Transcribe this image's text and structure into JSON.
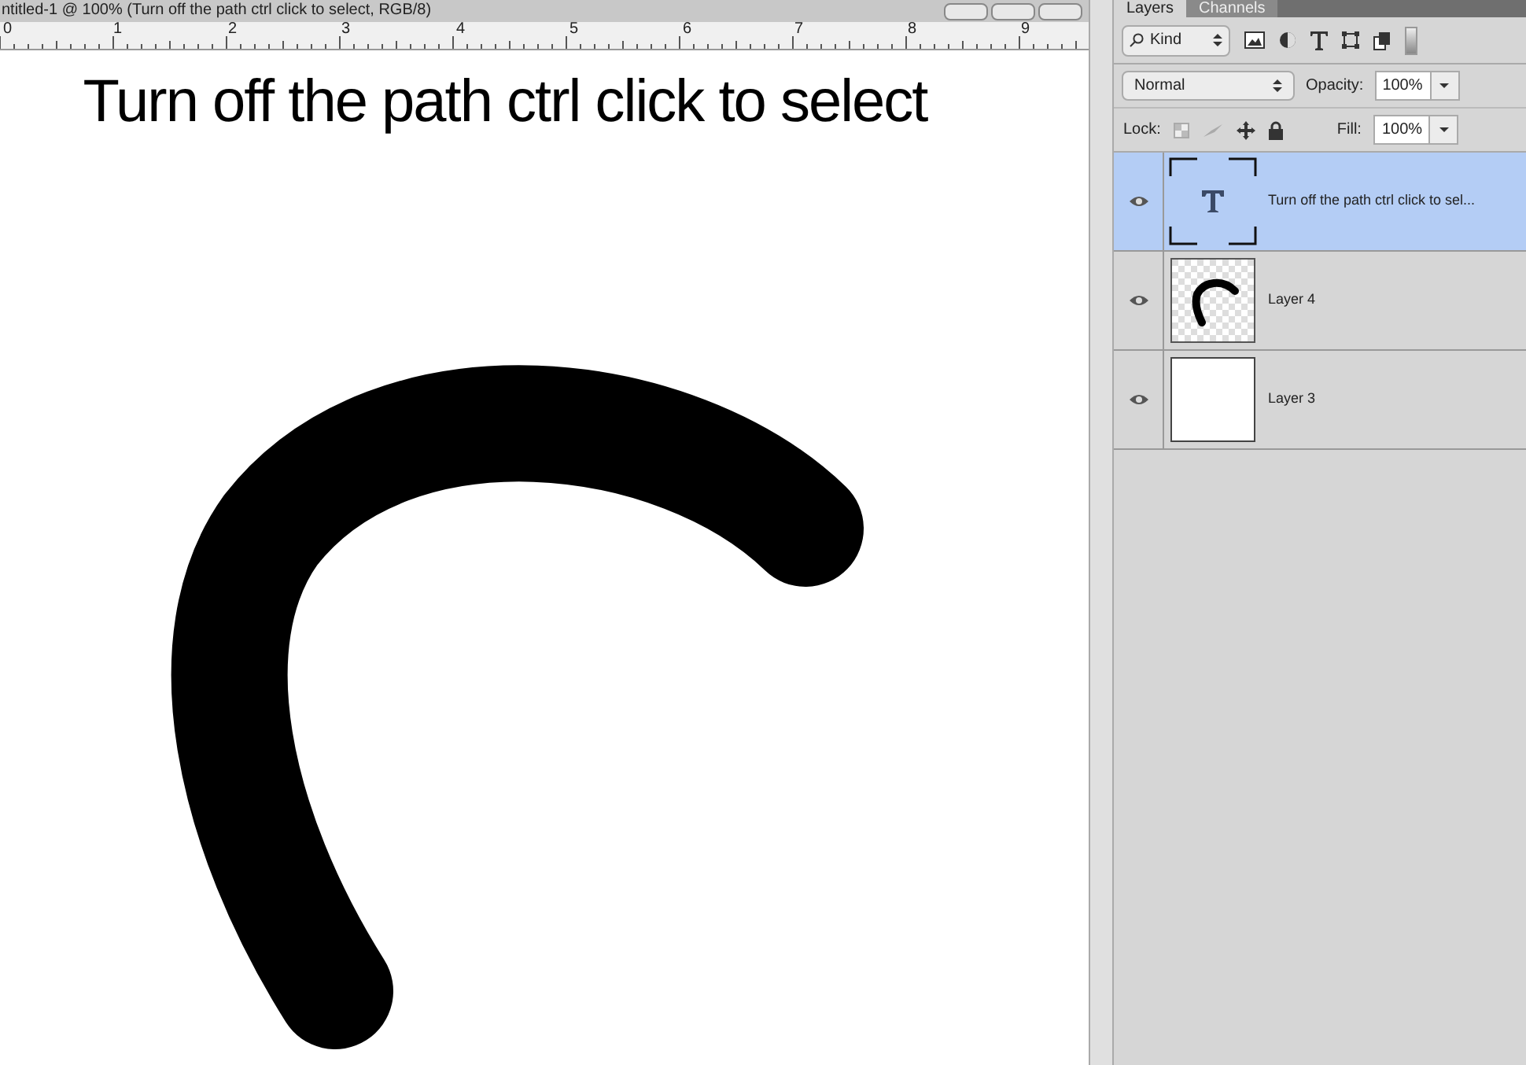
{
  "document": {
    "title": "ntitled-1 @ 100% (Turn off the path ctrl click to select, RGB/8)",
    "ruler_labels": [
      "0",
      "1",
      "2",
      "3",
      "4",
      "5",
      "6",
      "7",
      "8",
      "9"
    ],
    "canvas_text": "Turn off the path ctrl click to select"
  },
  "layers_panel": {
    "tabs": [
      {
        "label": "Layers",
        "selected": true
      },
      {
        "label": "Channels",
        "selected": false
      }
    ],
    "filter": {
      "value": "Kind"
    },
    "blend_mode": {
      "value": "Normal"
    },
    "opacity": {
      "label": "Opacity:",
      "value": "100%"
    },
    "lock_label": "Lock:",
    "fill": {
      "label": "Fill:",
      "value": "100%"
    },
    "layers": [
      {
        "name": "Turn off the path ctrl click to sel...",
        "kind": "text",
        "selected": true,
        "visible": true
      },
      {
        "name": "Layer 4",
        "kind": "stroke",
        "selected": false,
        "visible": true
      },
      {
        "name": "Layer 3",
        "kind": "fill",
        "selected": false,
        "visible": true
      }
    ]
  }
}
